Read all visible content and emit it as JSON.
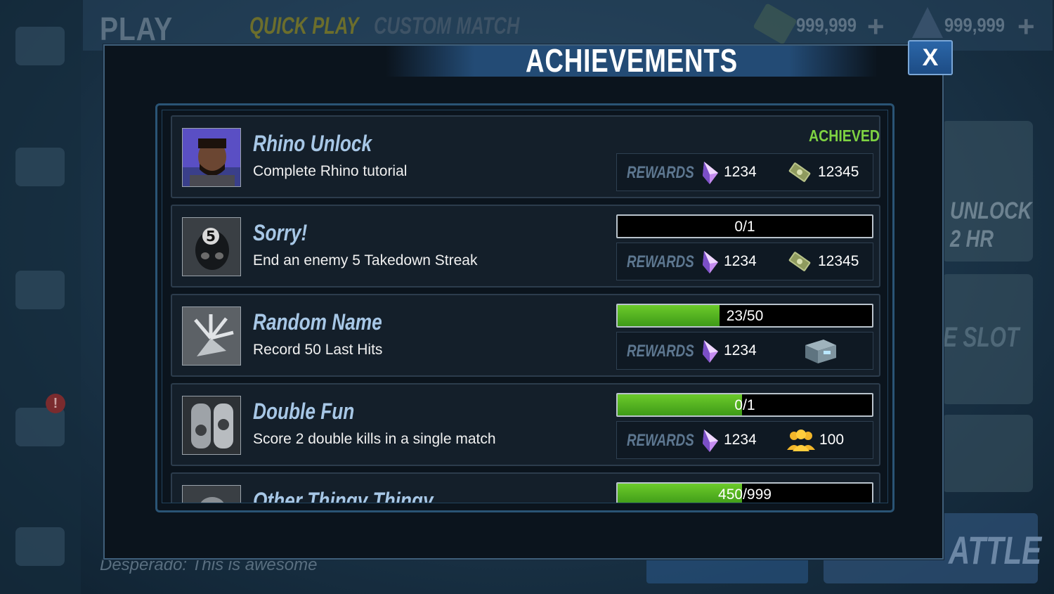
{
  "background": {
    "play_label": "PLAY",
    "tabs": [
      "QUICK PLAY",
      "CUSTOM MATCH"
    ],
    "currency": [
      {
        "icon": "cash-icon",
        "value": "999,999"
      },
      {
        "icon": "gem-icon",
        "value": "999,999"
      }
    ],
    "side_alert": "!",
    "unlock_text": "UNLOCK",
    "unlock_time": "2 HR",
    "slot_text": "E SLOT",
    "battle_text": "ATTLE",
    "chat_line": "Desperado: This is awesome"
  },
  "modal": {
    "title": "ACHIEVEMENTS",
    "close_label": "X"
  },
  "achievements": [
    {
      "title": "Rhino Unlock",
      "description": "Complete Rhino tutorial",
      "status": "ACHIEVED",
      "progress_text": null,
      "progress_fraction": null,
      "rewards_label": "REWARDS",
      "reward1": {
        "icon": "gem-icon",
        "value": "1234"
      },
      "reward2": {
        "icon": "cash-icon",
        "value": "12345"
      },
      "portrait": "rhino-portrait"
    },
    {
      "title": "Sorry!",
      "description": "End an enemy 5 Takedown Streak",
      "status": null,
      "progress_text": "0/1",
      "progress_fraction": 0,
      "rewards_label": "REWARDS",
      "reward1": {
        "icon": "gem-icon",
        "value": "1234"
      },
      "reward2": {
        "icon": "cash-icon",
        "value": "12345"
      },
      "portrait": "skull-five-badge"
    },
    {
      "title": "Random Name",
      "description": "Record 50 Last Hits",
      "status": null,
      "progress_text": "23/50",
      "progress_fraction": 0.4,
      "rewards_label": "REWARDS",
      "reward1": {
        "icon": "gem-icon",
        "value": "1234"
      },
      "reward2": {
        "icon": "crate-icon",
        "value": ""
      },
      "portrait": "claw-hand"
    },
    {
      "title": "Double Fun",
      "description": "Score 2 double kills in a single match",
      "status": null,
      "progress_text": "0/1",
      "progress_fraction": 0.49,
      "rewards_label": "REWARDS",
      "reward1": {
        "icon": "gem-icon",
        "value": "1234"
      },
      "reward2": {
        "icon": "team-icon",
        "value": "100"
      },
      "portrait": "dog-tags"
    },
    {
      "title": "Other Thingy Thingy",
      "description": "",
      "status": null,
      "progress_text": "450/999",
      "progress_fraction": 0.49,
      "rewards_label": "REWARDS",
      "reward1": {
        "icon": "gem-icon",
        "value": ""
      },
      "reward2": {
        "icon": "",
        "value": ""
      },
      "portrait": "generic-portrait"
    }
  ],
  "colors": {
    "achieved": "#7ed242",
    "progress_fill": "#4fb31f",
    "title_text": "#a7c7e6",
    "modal_bg": "#0b141d"
  }
}
